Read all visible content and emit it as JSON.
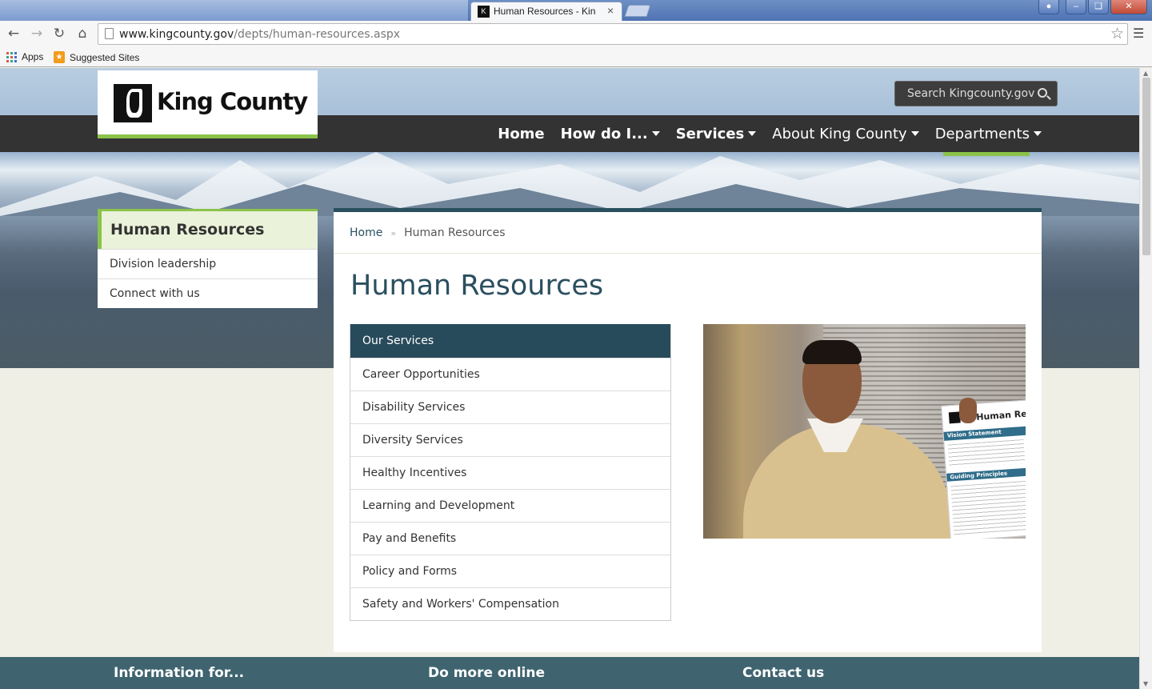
{
  "browser": {
    "tab_title": "Human Resources - King C",
    "tab_close": "×",
    "url_host": "www.kingcounty.gov",
    "url_path": "/depts/human-resources.aspx",
    "bookmarks": [
      {
        "label": "Apps"
      },
      {
        "label": "Suggested Sites"
      }
    ]
  },
  "header": {
    "logo_text": "King County",
    "search_placeholder": "Search Kingcounty.gov",
    "nav": [
      {
        "label": "Home",
        "bold": true,
        "dropdown": false
      },
      {
        "label": "How do I...",
        "bold": true,
        "dropdown": true
      },
      {
        "label": "Services",
        "bold": true,
        "dropdown": true
      },
      {
        "label": "About King County",
        "bold": false,
        "dropdown": true
      },
      {
        "label": "Departments",
        "bold": false,
        "dropdown": true
      }
    ],
    "accent_color": "#8bc34a",
    "bar_color": "#333333"
  },
  "sidebar": {
    "title": "Human Resources",
    "items": [
      {
        "label": "Division leadership"
      },
      {
        "label": "Connect with us"
      }
    ]
  },
  "main": {
    "breadcrumb": {
      "home": "Home",
      "sep": "»",
      "current": "Human Resources"
    },
    "title": "Human Resources",
    "services": {
      "heading": "Our Services",
      "items": [
        "Career Opportunities",
        "Disability Services",
        "Diversity Services",
        "Healthy Incentives",
        "Learning and Development",
        "Pay and Benefits",
        "Policy and Forms",
        "Safety and Workers' Compensation"
      ]
    },
    "photo": {
      "poster_title": "Human Res",
      "poster_band_1": "Vision Statement",
      "poster_band_2": "Guiding Principles"
    },
    "primary_color": "#2a4f5f"
  },
  "footer": {
    "headings": [
      "Information for...",
      "Do more online",
      "Contact us"
    ],
    "color": "#3f6470"
  }
}
